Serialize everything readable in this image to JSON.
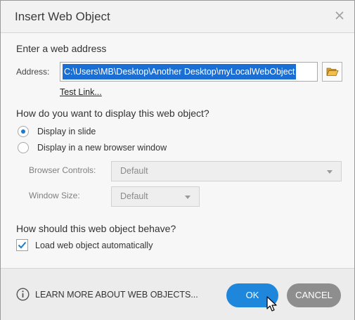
{
  "dialog": {
    "title": "Insert Web Object",
    "close_glyph": "×"
  },
  "address_section": {
    "heading": "Enter a web address",
    "label": "Address:",
    "value": "C:\\Users\\MB\\Desktop\\Another Desktop\\myLocalWebObject",
    "browse_icon": "folder-open-icon",
    "test_link": "Test Link..."
  },
  "display_section": {
    "heading": "How do you want to display this web object?",
    "options": [
      {
        "label": "Display in slide",
        "selected": true
      },
      {
        "label": "Display in a new browser window",
        "selected": false
      }
    ],
    "browser_controls": {
      "label": "Browser Controls:",
      "value": "Default"
    },
    "window_size": {
      "label": "Window Size:",
      "value": "Default"
    }
  },
  "behave_section": {
    "heading": "How should this web object behave?",
    "load_auto": {
      "label": "Load web object automatically",
      "checked": true
    }
  },
  "footer": {
    "learn_more": "LEARN MORE ABOUT WEB OBJECTS...",
    "ok": "OK",
    "cancel": "CANCEL"
  },
  "colors": {
    "accent": "#1e87dc",
    "selection": "#1b6fd4",
    "cancel": "#8e8e8e"
  }
}
